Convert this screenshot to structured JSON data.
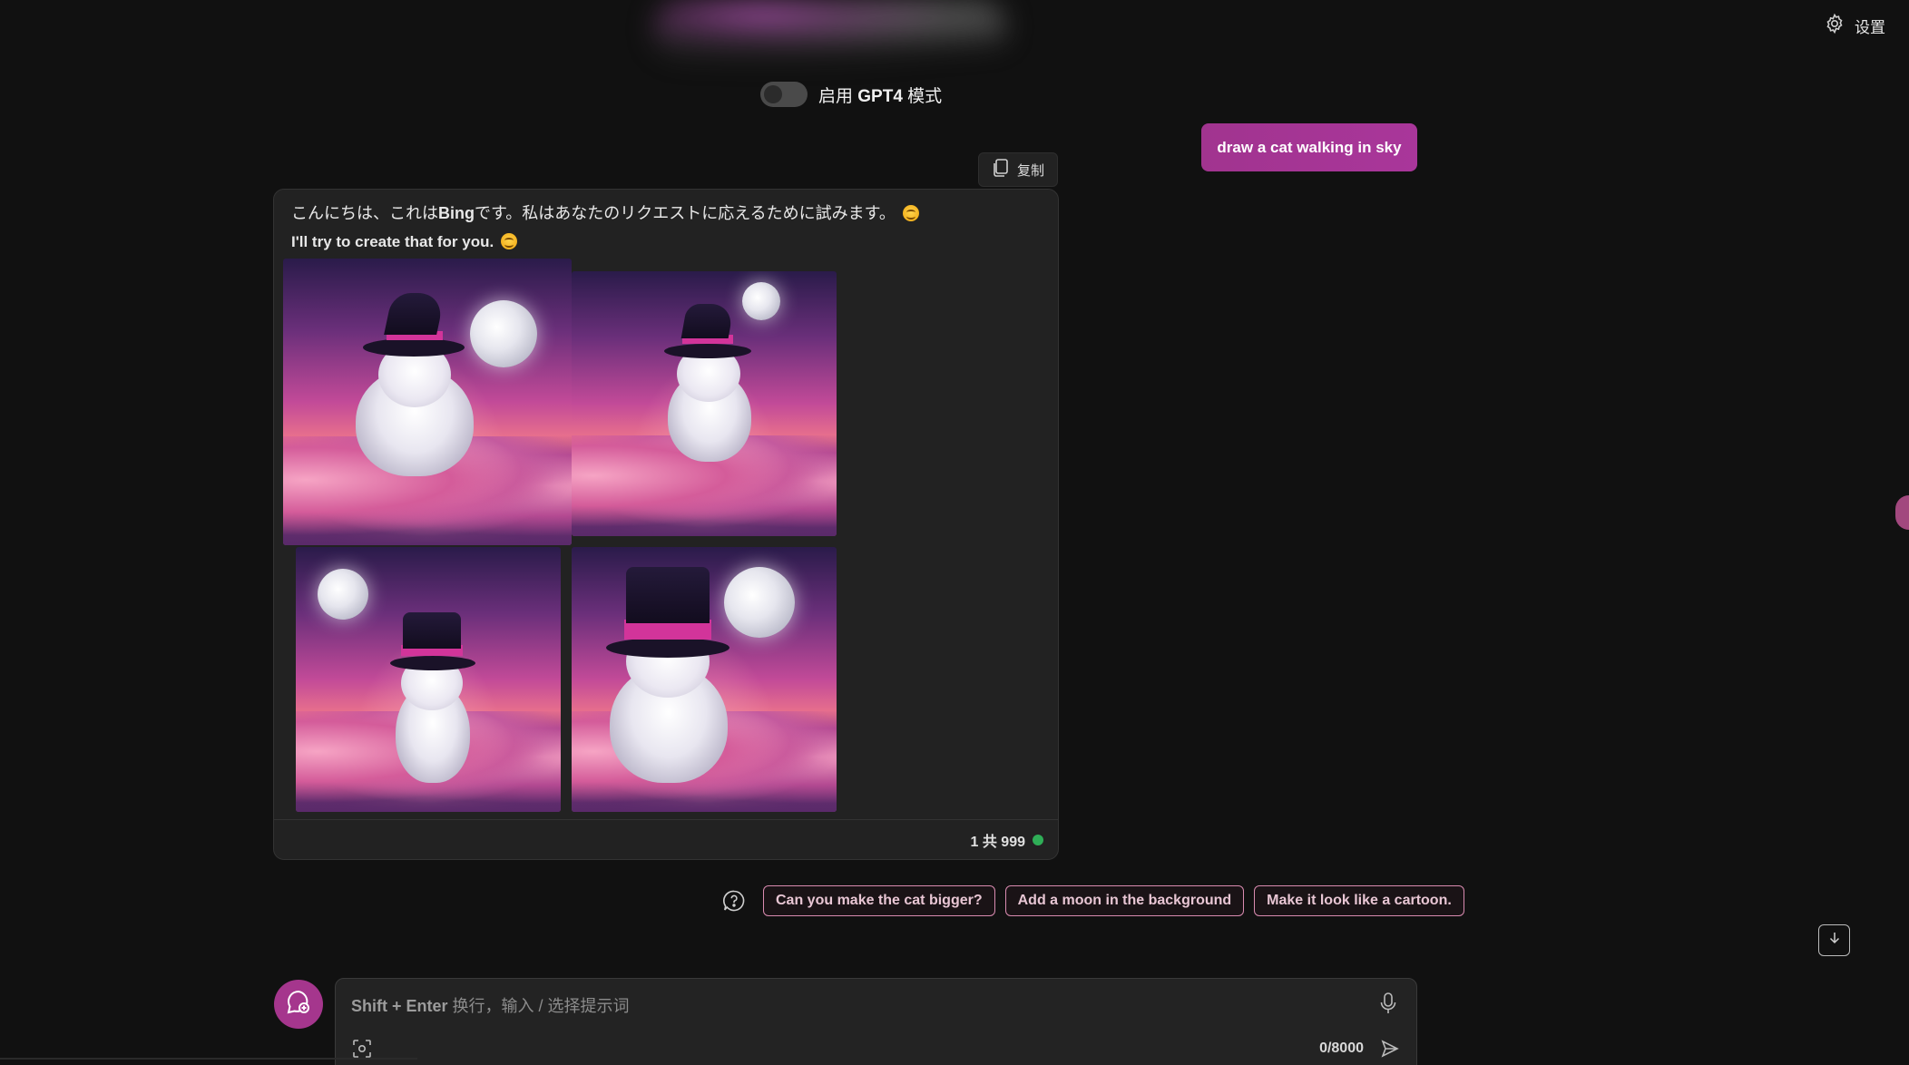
{
  "header": {
    "settings_label": "设置",
    "gpt4_toggle": {
      "prefix": "启用 ",
      "bold": "GPT4",
      "suffix": " 模式",
      "enabled": false
    }
  },
  "conversation": {
    "user_message": "draw a cat walking in sky",
    "copy_label": "复制",
    "bot": {
      "line1_prefix": "こんにちは、これは",
      "line1_bold": "Bing",
      "line1_suffix": "です。私はあなたのリクエストに応えるために試みます。",
      "line2": "I'll try to create that for you.",
      "emoji_icon": "smiling-face-emoji"
    },
    "counter": {
      "text": "1 共 999",
      "status_color": "#2fae57"
    }
  },
  "suggestions": [
    "Can you make the cat bigger?",
    "Add a moon in the background",
    "Make it look like a cartoon."
  ],
  "composer": {
    "placeholder_bold": "Shift + Enter",
    "placeholder_rest": " 换行，输入 / 选择提示词",
    "char_count": "0/8000"
  },
  "colors": {
    "accent": "#a5368d",
    "background": "#111111",
    "card": "#222222",
    "chip_border": "#d98bb0"
  }
}
